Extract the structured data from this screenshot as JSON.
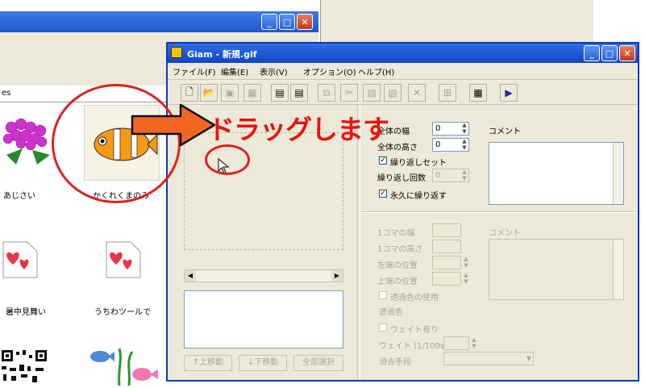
{
  "explorer": {
    "address_fragment": "es",
    "items": [
      {
        "label": "あじさい",
        "icon": "hydrangea-icon"
      },
      {
        "label": "かくれくまのみ",
        "icon": "clownfish-icon"
      },
      {
        "label": "暑中見舞い",
        "icon": "hearts-file-icon"
      },
      {
        "label": "うちわツールで",
        "icon": "hearts-file-icon"
      }
    ]
  },
  "annotation": {
    "drag_text": "ドラッグします",
    "drag_color": "#e8130f",
    "arrow_color": "#f26522",
    "circle_color": "#e02020"
  },
  "giam": {
    "title": "Giam - 新規.gif",
    "menu": [
      "ファイル(F)",
      "編集(E)",
      "表示(V)",
      "オプション(O)",
      "ヘルプ(H)"
    ],
    "frame_buttons": [
      "↑上移動",
      "↓下移動",
      "全部選択"
    ],
    "settings": {
      "width_label": "全体の幅",
      "width_value": "0",
      "height_label": "全体の高さ",
      "height_value": "0",
      "comment_label": "コメント",
      "loop_set_label": "繰り返しセット",
      "loop_count_label": "繰り返し回数",
      "loop_count_value": "0",
      "forever_label": "永久に繰り返す"
    },
    "frame_settings": {
      "frame_width_label": "1コマの幅",
      "frame_height_label": "1コマの高さ",
      "left_pos_label": "左端の位置",
      "top_pos_label": "上端の位置",
      "comment_label": "コメント",
      "transparent_use_label": "透過色の使用",
      "transparent_color_label": "透過色",
      "wait_label": "ウェイト有り",
      "wait_unit_label": "ウェイト (1/100s)",
      "dispose_label": "消去手段"
    }
  }
}
